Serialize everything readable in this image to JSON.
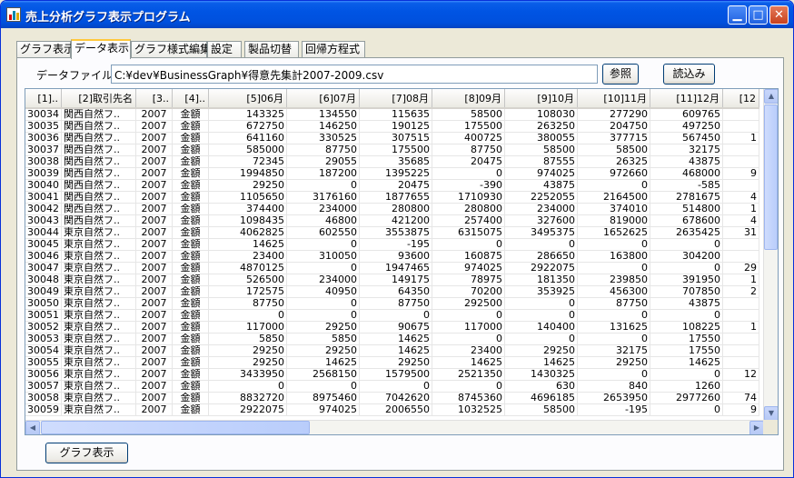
{
  "window": {
    "title": "売上分析グラフ表示プログラム"
  },
  "tabs": [
    {
      "label": "グラフ表示"
    },
    {
      "label": "データ表示"
    },
    {
      "label": "グラフ様式編集"
    },
    {
      "label": "設定"
    },
    {
      "label": "製品切替"
    },
    {
      "label": "回帰方程式"
    }
  ],
  "file": {
    "label": "データファイル名",
    "value": "C:¥dev¥BusinessGraph¥得意先集計2007-2009.csv",
    "browse_label": "参照",
    "load_label": "読込み"
  },
  "grid": {
    "columns": [
      "[1]..",
      "[2]取引先名",
      "[3..",
      "[4]..",
      "[5]06月",
      "[6]07月",
      "[7]08月",
      "[8]09月",
      "[9]10月",
      "[10]11月",
      "[11]12月",
      "[12"
    ],
    "rows": [
      [
        "30034",
        "関西自然フ..",
        "2007",
        "金額",
        "143325",
        "134550",
        "115635",
        "58500",
        "108030",
        "277290",
        "609765",
        ""
      ],
      [
        "30035",
        "関西自然フ..",
        "2007",
        "金額",
        "672750",
        "146250",
        "190125",
        "175500",
        "263250",
        "204750",
        "497250",
        ""
      ],
      [
        "30036",
        "関西自然フ..",
        "2007",
        "金額",
        "641160",
        "330525",
        "307515",
        "400725",
        "380055",
        "377715",
        "567450",
        "1"
      ],
      [
        "30037",
        "関西自然フ..",
        "2007",
        "金額",
        "585000",
        "87750",
        "175500",
        "87750",
        "58500",
        "58500",
        "32175",
        ""
      ],
      [
        "30038",
        "関西自然フ..",
        "2007",
        "金額",
        "72345",
        "29055",
        "35685",
        "20475",
        "87555",
        "26325",
        "43875",
        ""
      ],
      [
        "30039",
        "関西自然フ..",
        "2007",
        "金額",
        "1994850",
        "187200",
        "1395225",
        "0",
        "974025",
        "972660",
        "468000",
        "9"
      ],
      [
        "30040",
        "関西自然フ..",
        "2007",
        "金額",
        "29250",
        "0",
        "20475",
        "-390",
        "43875",
        "0",
        "-585",
        ""
      ],
      [
        "30041",
        "関西自然フ..",
        "2007",
        "金額",
        "1105650",
        "3176160",
        "1877655",
        "1710930",
        "2252055",
        "2164500",
        "2781675",
        "4"
      ],
      [
        "30042",
        "関西自然フ..",
        "2007",
        "金額",
        "374400",
        "234000",
        "280800",
        "280800",
        "234000",
        "374010",
        "514800",
        "1"
      ],
      [
        "30043",
        "関西自然フ..",
        "2007",
        "金額",
        "1098435",
        "46800",
        "421200",
        "257400",
        "327600",
        "819000",
        "678600",
        "4"
      ],
      [
        "30044",
        "東京自然フ..",
        "2007",
        "金額",
        "4062825",
        "602550",
        "3553875",
        "6315075",
        "3495375",
        "1652625",
        "2635425",
        "31"
      ],
      [
        "30045",
        "東京自然フ..",
        "2007",
        "金額",
        "14625",
        "0",
        "-195",
        "0",
        "0",
        "0",
        "0",
        ""
      ],
      [
        "30046",
        "東京自然フ..",
        "2007",
        "金額",
        "23400",
        "310050",
        "93600",
        "160875",
        "286650",
        "163800",
        "304200",
        ""
      ],
      [
        "30047",
        "東京自然フ..",
        "2007",
        "金額",
        "4870125",
        "0",
        "1947465",
        "974025",
        "2922075",
        "0",
        "0",
        "29"
      ],
      [
        "30048",
        "東京自然フ..",
        "2007",
        "金額",
        "526500",
        "234000",
        "149175",
        "78975",
        "181350",
        "239850",
        "391950",
        "1"
      ],
      [
        "30049",
        "東京自然フ..",
        "2007",
        "金額",
        "172575",
        "40950",
        "64350",
        "70200",
        "353925",
        "456300",
        "707850",
        "2"
      ],
      [
        "30050",
        "東京自然フ..",
        "2007",
        "金額",
        "87750",
        "0",
        "87750",
        "292500",
        "0",
        "87750",
        "43875",
        ""
      ],
      [
        "30051",
        "東京自然フ..",
        "2007",
        "金額",
        "0",
        "0",
        "0",
        "0",
        "0",
        "0",
        "0",
        ""
      ],
      [
        "30052",
        "東京自然フ..",
        "2007",
        "金額",
        "117000",
        "29250",
        "90675",
        "117000",
        "140400",
        "131625",
        "108225",
        "1"
      ],
      [
        "30053",
        "東京自然フ..",
        "2007",
        "金額",
        "5850",
        "5850",
        "14625",
        "0",
        "0",
        "0",
        "17550",
        ""
      ],
      [
        "30054",
        "東京自然フ..",
        "2007",
        "金額",
        "29250",
        "29250",
        "14625",
        "23400",
        "29250",
        "32175",
        "17550",
        ""
      ],
      [
        "30055",
        "東京自然フ..",
        "2007",
        "金額",
        "29250",
        "14625",
        "29250",
        "14625",
        "14625",
        "29250",
        "14625",
        ""
      ],
      [
        "30056",
        "東京自然フ..",
        "2007",
        "金額",
        "3433950",
        "2568150",
        "1579500",
        "2521350",
        "1430325",
        "0",
        "0",
        "12"
      ],
      [
        "30057",
        "東京自然フ..",
        "2007",
        "金額",
        "0",
        "0",
        "0",
        "0",
        "630",
        "840",
        "1260",
        ""
      ],
      [
        "30058",
        "東京自然フ..",
        "2007",
        "金額",
        "8832720",
        "8975460",
        "7042620",
        "8745360",
        "4696185",
        "2653950",
        "2977260",
        "74"
      ],
      [
        "30059",
        "東京自然フ..",
        "2007",
        "金額",
        "2922075",
        "974025",
        "2006550",
        "1032525",
        "58500",
        "-195",
        "0",
        "9"
      ]
    ]
  },
  "footer": {
    "show_graph_label": "グラフ表示"
  }
}
